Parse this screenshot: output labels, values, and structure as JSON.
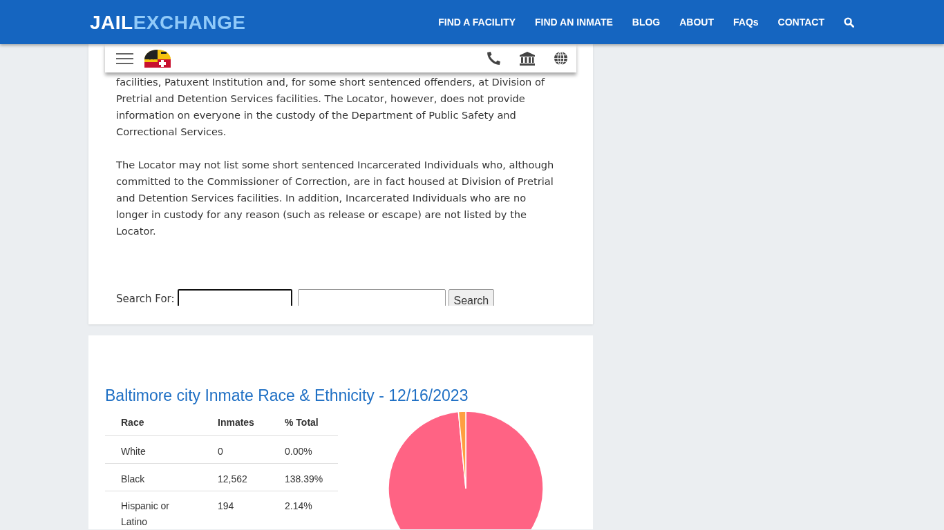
{
  "header": {
    "logo": {
      "part_1": "JAIL",
      "part_2": "EXCHANGE"
    },
    "nav": [
      "FIND A FACILITY",
      "FIND AN INMATE",
      "BLOG",
      "ABOUT",
      "FAQs",
      "CONTACT"
    ]
  },
  "locator_card": {
    "paragraphs": [
      "facilities, Patuxent Institution and, for some short sentenced offenders, at Division of Pretrial and Detention Services facilities. The Locator, however, does not provide information on everyone in the custody of the Department of Public Safety and Correctional Services.",
      "The Locator may not list some short sentenced Incarcerated Individuals who, although committed to the Commissioner of Correction, are in fact housed at Division of Pretrial and Detention Services facilities. In addition, Incarcerated Individuals who are no longer in custody for any reason (such as release or escape) are not listed by the Locator."
    ],
    "search": {
      "label": "Search For:",
      "button": "Search"
    }
  },
  "race_card": {
    "title": "Baltimore city Inmate Race & Ethnicity - 12/16/2023",
    "columns": [
      "Race",
      "Inmates",
      "% Total"
    ],
    "rows": [
      [
        "White",
        "0",
        "0.00%"
      ],
      [
        "Black",
        "12,562",
        "138.39%"
      ],
      [
        "Hispanic or Latino",
        "194",
        "2.14%"
      ]
    ]
  }
}
